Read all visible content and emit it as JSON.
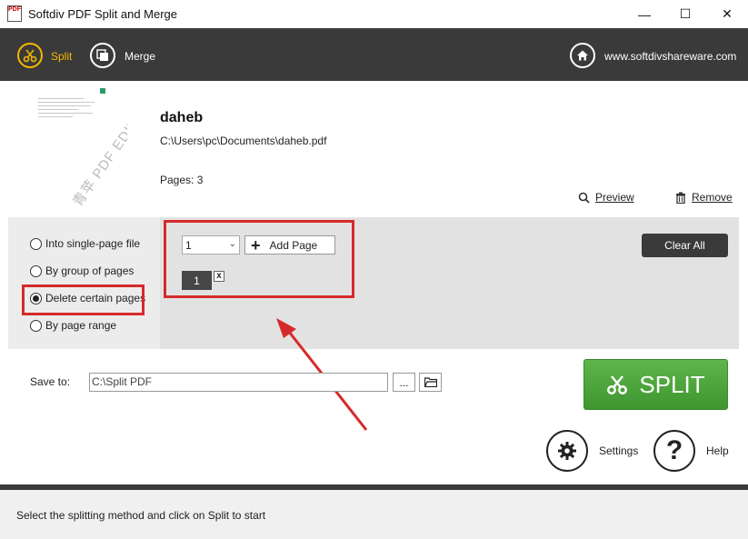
{
  "window": {
    "title": "Softdiv PDF Split and Merge",
    "icon_text": "PDF",
    "controls": {
      "minimize": "—",
      "maximize": "☐",
      "close": "✕"
    }
  },
  "toolbar": {
    "items": [
      {
        "label": "Split",
        "icon": "scissors-icon",
        "active": true
      },
      {
        "label": "Merge",
        "icon": "merge-icon",
        "active": false
      }
    ],
    "website": "www.softdivshareware.com",
    "accent": "#f5b800"
  },
  "file": {
    "name": "daheb",
    "path": "C:\\Users\\pc\\Documents\\daheb.pdf",
    "pages": "Pages: 3",
    "thumbnail_watermark": "青苹 PDF EDITOR",
    "preview_label": "Preview",
    "remove_label": "Remove"
  },
  "methods": {
    "options": [
      {
        "label": "Into single-page file",
        "checked": false
      },
      {
        "label": "By group of pages",
        "checked": false
      },
      {
        "label": "Delete certain pages",
        "checked": true
      },
      {
        "label": "By page range",
        "checked": false
      }
    ]
  },
  "delete_pages": {
    "selected_page": "1",
    "add_label": "Add Page",
    "add_symbol": "+",
    "chips": [
      "1"
    ],
    "chip_remove": "x",
    "clear_label": "Clear All"
  },
  "save": {
    "label": "Save to:",
    "value": "C:\\Split PDF",
    "browse_label": "...",
    "folder_icon": "folder-icon"
  },
  "actions": {
    "split_label": "SPLIT",
    "split_color": "#4ea63b",
    "settings_label": "Settings",
    "help_label": "Help",
    "help_symbol": "?"
  },
  "status": {
    "text": "Select the splitting method and click on Split to start"
  },
  "annotation_color": "#d62a2a"
}
